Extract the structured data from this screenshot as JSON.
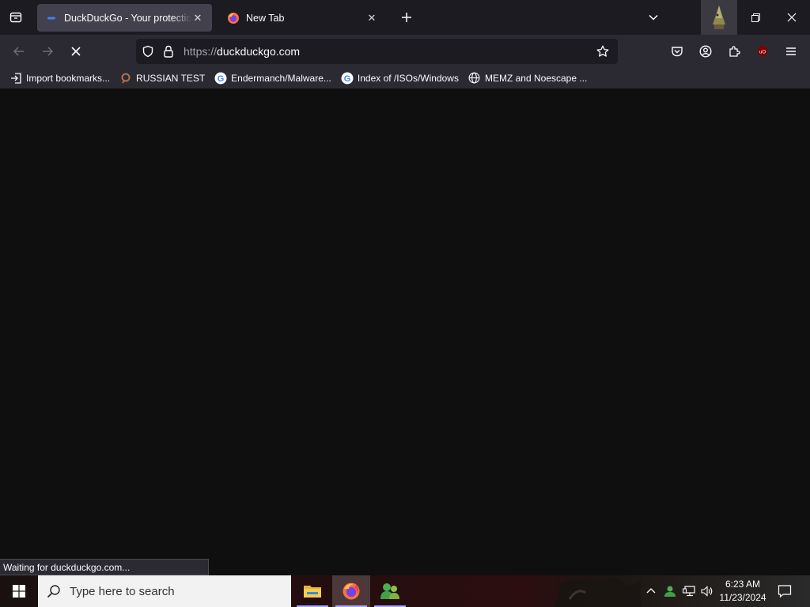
{
  "browser": {
    "tabs": [
      {
        "title": "DuckDuckGo - Your protection, our priority",
        "active": true,
        "favicon": "duckduckgo-icon"
      },
      {
        "title": "New Tab",
        "active": false,
        "favicon": "firefox-icon"
      }
    ],
    "tab_close_glyph": "✕",
    "new_tab_glyph": "+",
    "url": {
      "scheme": "https://",
      "host": "duckduckgo.com"
    },
    "bookmarks": [
      {
        "label": "Import bookmarks...",
        "icon": "import-icon"
      },
      {
        "label": "RUSSIAN TEST",
        "icon": "search-icon"
      },
      {
        "label": "Endermanch/Malware...",
        "icon": "google-icon"
      },
      {
        "label": "Index of /ISOs/Windows",
        "icon": "google-icon"
      },
      {
        "label": "MEMZ and Noescape ...",
        "icon": "globe-icon"
      }
    ],
    "status_text": "Waiting for duckduckgo.com...",
    "colors": {
      "tab_active": "#42414d",
      "toolbar": "#2b2a33",
      "content": "#0f0f10"
    }
  },
  "taskbar": {
    "search_placeholder": "Type here to search",
    "apps": [
      {
        "name": "file-explorer-icon",
        "running": true
      },
      {
        "name": "firefox-icon",
        "running": true,
        "active": true
      },
      {
        "name": "people-icon",
        "running": true
      }
    ],
    "clock": {
      "time": "6:23 AM",
      "date": "11/23/2024"
    }
  }
}
